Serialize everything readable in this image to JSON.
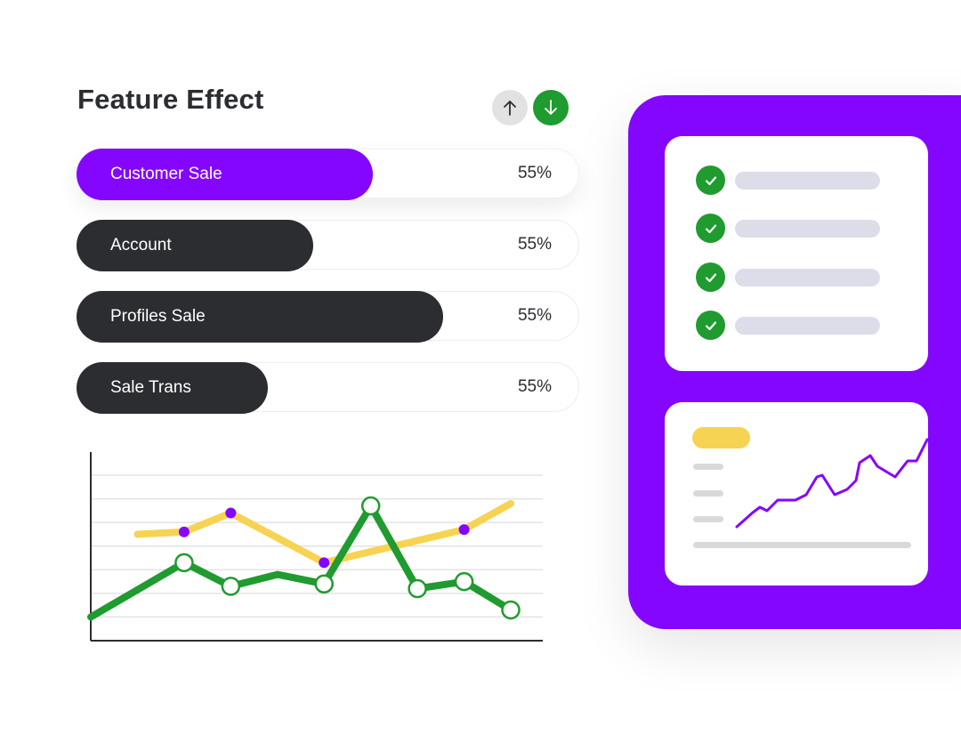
{
  "header": {
    "title": "Feature Effect"
  },
  "sort": {
    "up_icon": "arrow-up-icon",
    "down_icon": "arrow-down-icon"
  },
  "bars": [
    {
      "label": "Customer Sale",
      "value": "55%",
      "fill_fraction": 0.59,
      "color": "#8506ff",
      "active": true
    },
    {
      "label": "Account",
      "value": "55%",
      "fill_fraction": 0.47,
      "color": "#2b2d31",
      "active": false
    },
    {
      "label": "Profiles Sale",
      "value": "55%",
      "fill_fraction": 0.73,
      "color": "#2b2d31",
      "active": false
    },
    {
      "label": "Sale Trans",
      "value": "55%",
      "fill_fraction": 0.38,
      "color": "#2b2d31",
      "active": false
    }
  ],
  "chart_data": {
    "type": "line",
    "grid": true,
    "x": [
      0,
      1,
      2,
      3,
      4,
      5,
      6,
      7,
      8,
      9
    ],
    "ylim": [
      0,
      7
    ],
    "series": [
      {
        "color": "#f7d353",
        "values": [
          null,
          4.5,
          4.6,
          5.4,
          null,
          3.3,
          null,
          null,
          4.7,
          5.8
        ],
        "markers": [
          2,
          3,
          5,
          8
        ]
      },
      {
        "color": "#1f9b2f",
        "values": [
          1.0,
          null,
          3.3,
          2.3,
          2.8,
          2.4,
          5.7,
          2.2,
          2.5,
          1.3
        ],
        "markers": [
          2,
          3,
          5,
          6,
          7,
          8,
          9
        ]
      }
    ]
  },
  "colors": {
    "accent": "#8506ff",
    "success": "#1f9b2f",
    "highlight": "#f7d353",
    "dark": "#2b2d31"
  },
  "checklist": {
    "count": 4,
    "icon": "check-icon"
  }
}
